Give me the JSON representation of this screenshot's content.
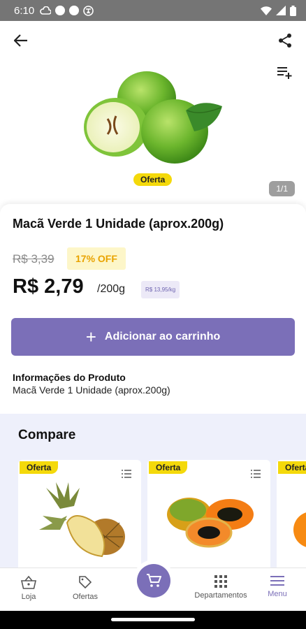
{
  "status_bar": {
    "time": "6:10"
  },
  "product": {
    "badge": "Oferta",
    "image_counter": "1/1",
    "title": "Macã Verde 1 Unidade (aprox.200g)",
    "old_price": "R$ 3,39",
    "discount": "17% OFF",
    "price": "R$ 2,79",
    "unit": "/200g",
    "price_per_kg": "R$ 13,95/kg",
    "add_to_cart": "Adicionar ao carrinho",
    "info_heading": "Informações do Produto",
    "info_text": "Macã Verde 1 Unidade (aprox.200g)"
  },
  "compare": {
    "heading": "Compare",
    "cards": [
      {
        "badge": "Oferta"
      },
      {
        "badge": "Oferta"
      },
      {
        "badge": "Oferta"
      }
    ]
  },
  "nav": {
    "items": [
      {
        "label": "Loja"
      },
      {
        "label": "Ofertas"
      },
      {
        "label": "Departamentos"
      },
      {
        "label": "Menu"
      }
    ]
  },
  "colors": {
    "accent": "#7b6fb8",
    "badge": "#f4d90b",
    "discount": "#e9a300",
    "compare_bg": "#eef0fb"
  }
}
